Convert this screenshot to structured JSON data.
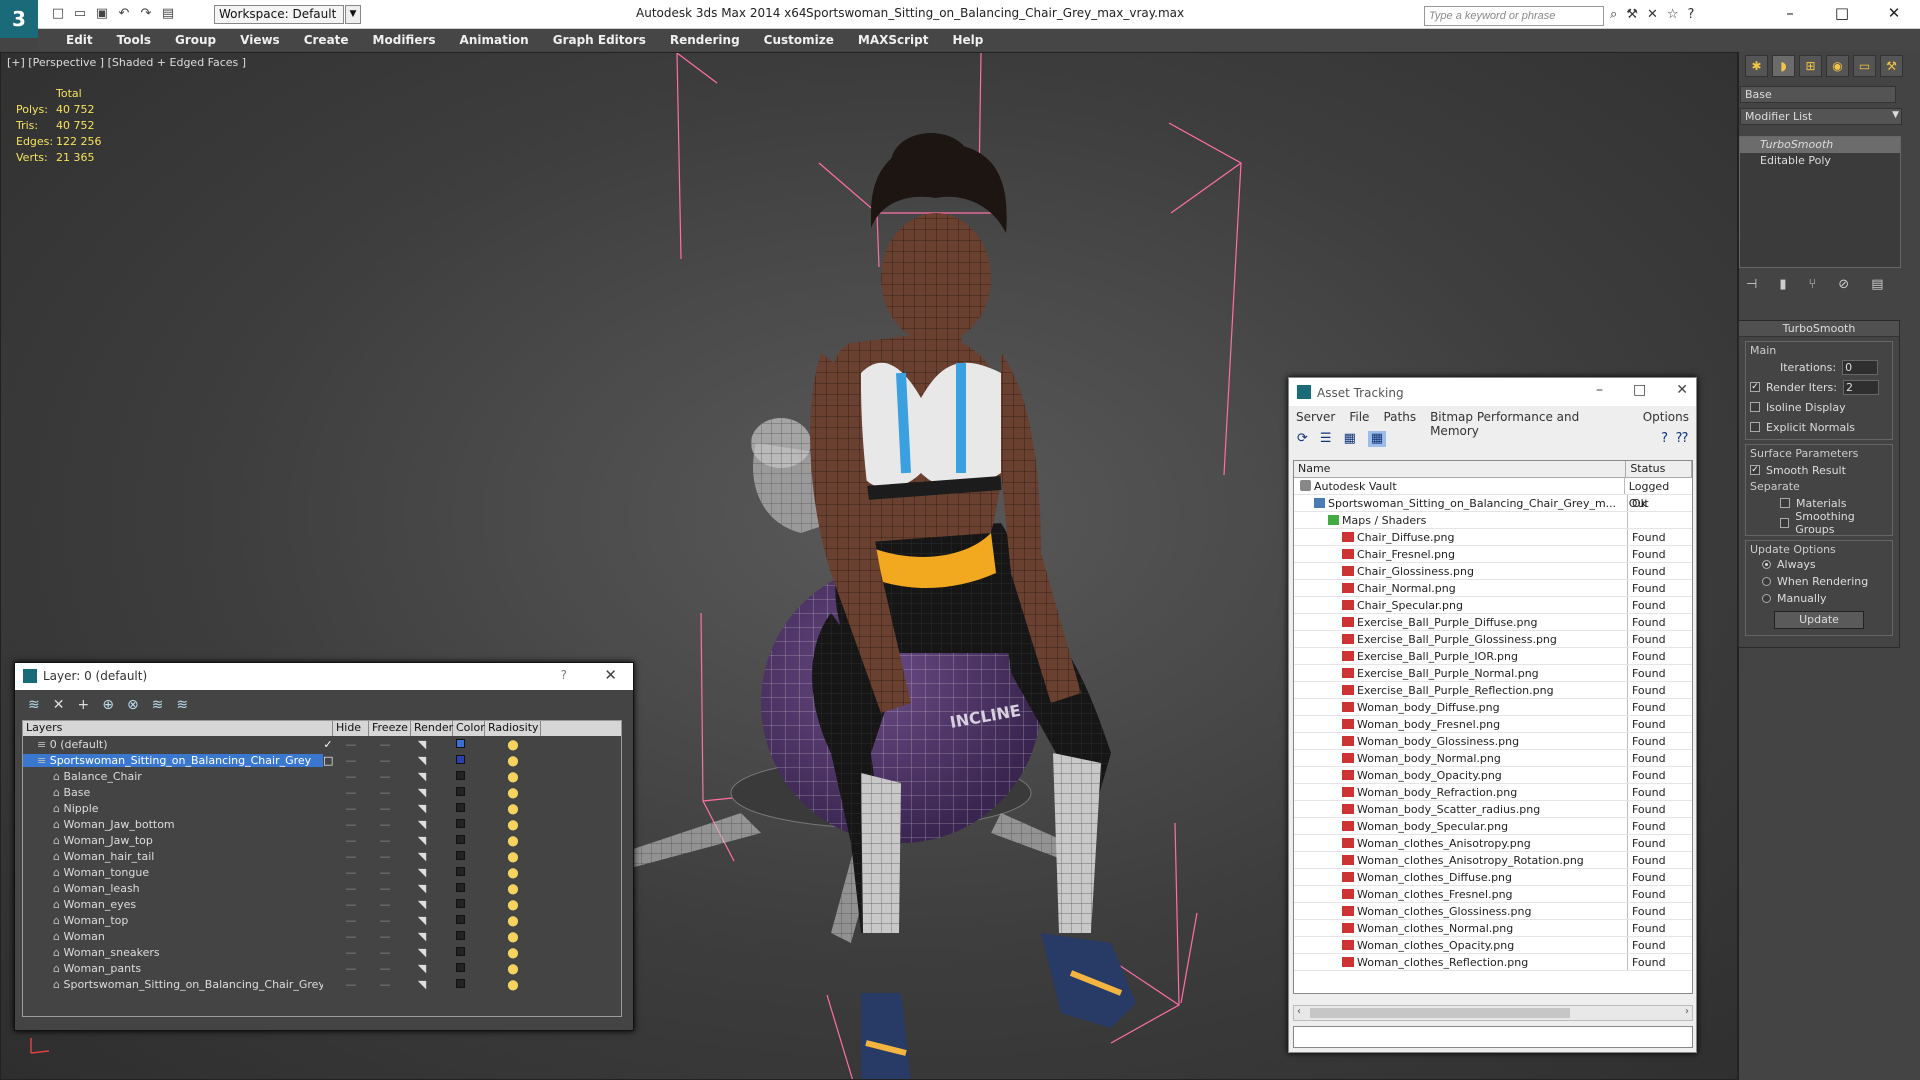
{
  "title_bar": {
    "workspace": "Workspace: Default",
    "app": "Autodesk 3ds Max  2014 x64",
    "file": "Sportswoman_Sitting_on_Balancing_Chair_Grey_max_vray.max",
    "search_placeholder": "Type a keyword or phrase"
  },
  "menu": [
    "Edit",
    "Tools",
    "Group",
    "Views",
    "Create",
    "Modifiers",
    "Animation",
    "Graph Editors",
    "Rendering",
    "Customize",
    "MAXScript",
    "Help"
  ],
  "viewport": {
    "label": "[+] [Perspective ] [Shaded + Edged Faces ]",
    "stats_header": "Total",
    "stats": [
      {
        "k": "Polys:",
        "v": "40 752"
      },
      {
        "k": "Tris:",
        "v": "40 752"
      },
      {
        "k": "Edges:",
        "v": "122 256"
      },
      {
        "k": "Verts:",
        "v": "21 365"
      }
    ],
    "ball_text": "INCLINE"
  },
  "command_panel": {
    "object_name": "Base",
    "modifier_list": "Modifier List",
    "stack": [
      "TurboSmooth",
      "Editable Poly"
    ],
    "rollout_title": "TurboSmooth",
    "main_label": "Main",
    "iterations_label": "Iterations:",
    "iterations_value": "0",
    "render_iters_label": "Render Iters:",
    "render_iters_value": "2",
    "isoline": "Isoline Display",
    "explicit_normals": "Explicit Normals",
    "surface_params": "Surface Parameters",
    "smooth_result": "Smooth Result",
    "separate": "Separate",
    "materials": "Materials",
    "smoothing_groups": "Smoothing Groups",
    "update_options": "Update Options",
    "always": "Always",
    "when_rendering": "When Rendering",
    "manually": "Manually",
    "update_button": "Update"
  },
  "layer_dialog": {
    "title": "Layer: 0 (default)",
    "help": "?",
    "columns": [
      "Layers",
      "Hide",
      "Freeze",
      "Render",
      "Color",
      "Radiosity"
    ],
    "rows": [
      {
        "name": "0 (default)",
        "indent": 1,
        "color": "#3a6fd8"
      },
      {
        "name": "Sportswoman_Sitting_on_Balancing_Chair_Grey",
        "indent": 1,
        "color": "#2a3fb0",
        "selected": true
      },
      {
        "name": "Balance_Chair",
        "indent": 2,
        "color": "#222222"
      },
      {
        "name": "Base",
        "indent": 2,
        "color": "#222222"
      },
      {
        "name": "Nipple",
        "indent": 2,
        "color": "#222222"
      },
      {
        "name": "Woman_Jaw_bottom",
        "indent": 2,
        "color": "#222222"
      },
      {
        "name": "Woman_Jaw_top",
        "indent": 2,
        "color": "#222222"
      },
      {
        "name": "Woman_hair_tail",
        "indent": 2,
        "color": "#222222"
      },
      {
        "name": "Woman_tongue",
        "indent": 2,
        "color": "#222222"
      },
      {
        "name": "Woman_leash",
        "indent": 2,
        "color": "#222222"
      },
      {
        "name": "Woman_eyes",
        "indent": 2,
        "color": "#222222"
      },
      {
        "name": "Woman_top",
        "indent": 2,
        "color": "#222222"
      },
      {
        "name": "Woman",
        "indent": 2,
        "color": "#222222"
      },
      {
        "name": "Woman_sneakers",
        "indent": 2,
        "color": "#222222"
      },
      {
        "name": "Woman_pants",
        "indent": 2,
        "color": "#222222"
      },
      {
        "name": "Sportswoman_Sitting_on_Balancing_Chair_Grey",
        "indent": 2,
        "color": "#222222"
      }
    ]
  },
  "asset_dialog": {
    "title": "Asset Tracking",
    "menu": [
      "Server",
      "File",
      "Paths",
      "Bitmap Performance and Memory",
      "Options"
    ],
    "col_name": "Name",
    "col_status": "Status",
    "rows": [
      {
        "name": "Autodesk Vault",
        "status": "Logged Out",
        "level": 0,
        "kind": "vault"
      },
      {
        "name": "Sportswoman_Sitting_on_Balancing_Chair_Grey_m...",
        "status": "Ok",
        "level": 1,
        "kind": "file"
      },
      {
        "name": "Maps / Shaders",
        "status": "",
        "level": 2,
        "kind": "dir"
      },
      {
        "name": "Chair_Diffuse.png",
        "status": "Found",
        "level": 3,
        "kind": "img"
      },
      {
        "name": "Chair_Fresnel.png",
        "status": "Found",
        "level": 3,
        "kind": "img"
      },
      {
        "name": "Chair_Glossiness.png",
        "status": "Found",
        "level": 3,
        "kind": "img"
      },
      {
        "name": "Chair_Normal.png",
        "status": "Found",
        "level": 3,
        "kind": "img"
      },
      {
        "name": "Chair_Specular.png",
        "status": "Found",
        "level": 3,
        "kind": "img"
      },
      {
        "name": "Exercise_Ball_Purple_Diffuse.png",
        "status": "Found",
        "level": 3,
        "kind": "img"
      },
      {
        "name": "Exercise_Ball_Purple_Glossiness.png",
        "status": "Found",
        "level": 3,
        "kind": "img"
      },
      {
        "name": "Exercise_Ball_Purple_IOR.png",
        "status": "Found",
        "level": 3,
        "kind": "img"
      },
      {
        "name": "Exercise_Ball_Purple_Normal.png",
        "status": "Found",
        "level": 3,
        "kind": "img"
      },
      {
        "name": "Exercise_Ball_Purple_Reflection.png",
        "status": "Found",
        "level": 3,
        "kind": "img"
      },
      {
        "name": "Woman_body_Diffuse.png",
        "status": "Found",
        "level": 3,
        "kind": "img"
      },
      {
        "name": "Woman_body_Fresnel.png",
        "status": "Found",
        "level": 3,
        "kind": "img"
      },
      {
        "name": "Woman_body_Glossiness.png",
        "status": "Found",
        "level": 3,
        "kind": "img"
      },
      {
        "name": "Woman_body_Normal.png",
        "status": "Found",
        "level": 3,
        "kind": "img"
      },
      {
        "name": "Woman_body_Opacity.png",
        "status": "Found",
        "level": 3,
        "kind": "img"
      },
      {
        "name": "Woman_body_Refraction.png",
        "status": "Found",
        "level": 3,
        "kind": "img"
      },
      {
        "name": "Woman_body_Scatter_radius.png",
        "status": "Found",
        "level": 3,
        "kind": "img"
      },
      {
        "name": "Woman_body_Specular.png",
        "status": "Found",
        "level": 3,
        "kind": "img"
      },
      {
        "name": "Woman_clothes_Anisotropy.png",
        "status": "Found",
        "level": 3,
        "kind": "img"
      },
      {
        "name": "Woman_clothes_Anisotropy_Rotation.png",
        "status": "Found",
        "level": 3,
        "kind": "img"
      },
      {
        "name": "Woman_clothes_Diffuse.png",
        "status": "Found",
        "level": 3,
        "kind": "img"
      },
      {
        "name": "Woman_clothes_Fresnel.png",
        "status": "Found",
        "level": 3,
        "kind": "img"
      },
      {
        "name": "Woman_clothes_Glossiness.png",
        "status": "Found",
        "level": 3,
        "kind": "img"
      },
      {
        "name": "Woman_clothes_Normal.png",
        "status": "Found",
        "level": 3,
        "kind": "img"
      },
      {
        "name": "Woman_clothes_Opacity.png",
        "status": "Found",
        "level": 3,
        "kind": "img"
      },
      {
        "name": "Woman_clothes_Reflection.png",
        "status": "Found",
        "level": 3,
        "kind": "img"
      }
    ]
  }
}
